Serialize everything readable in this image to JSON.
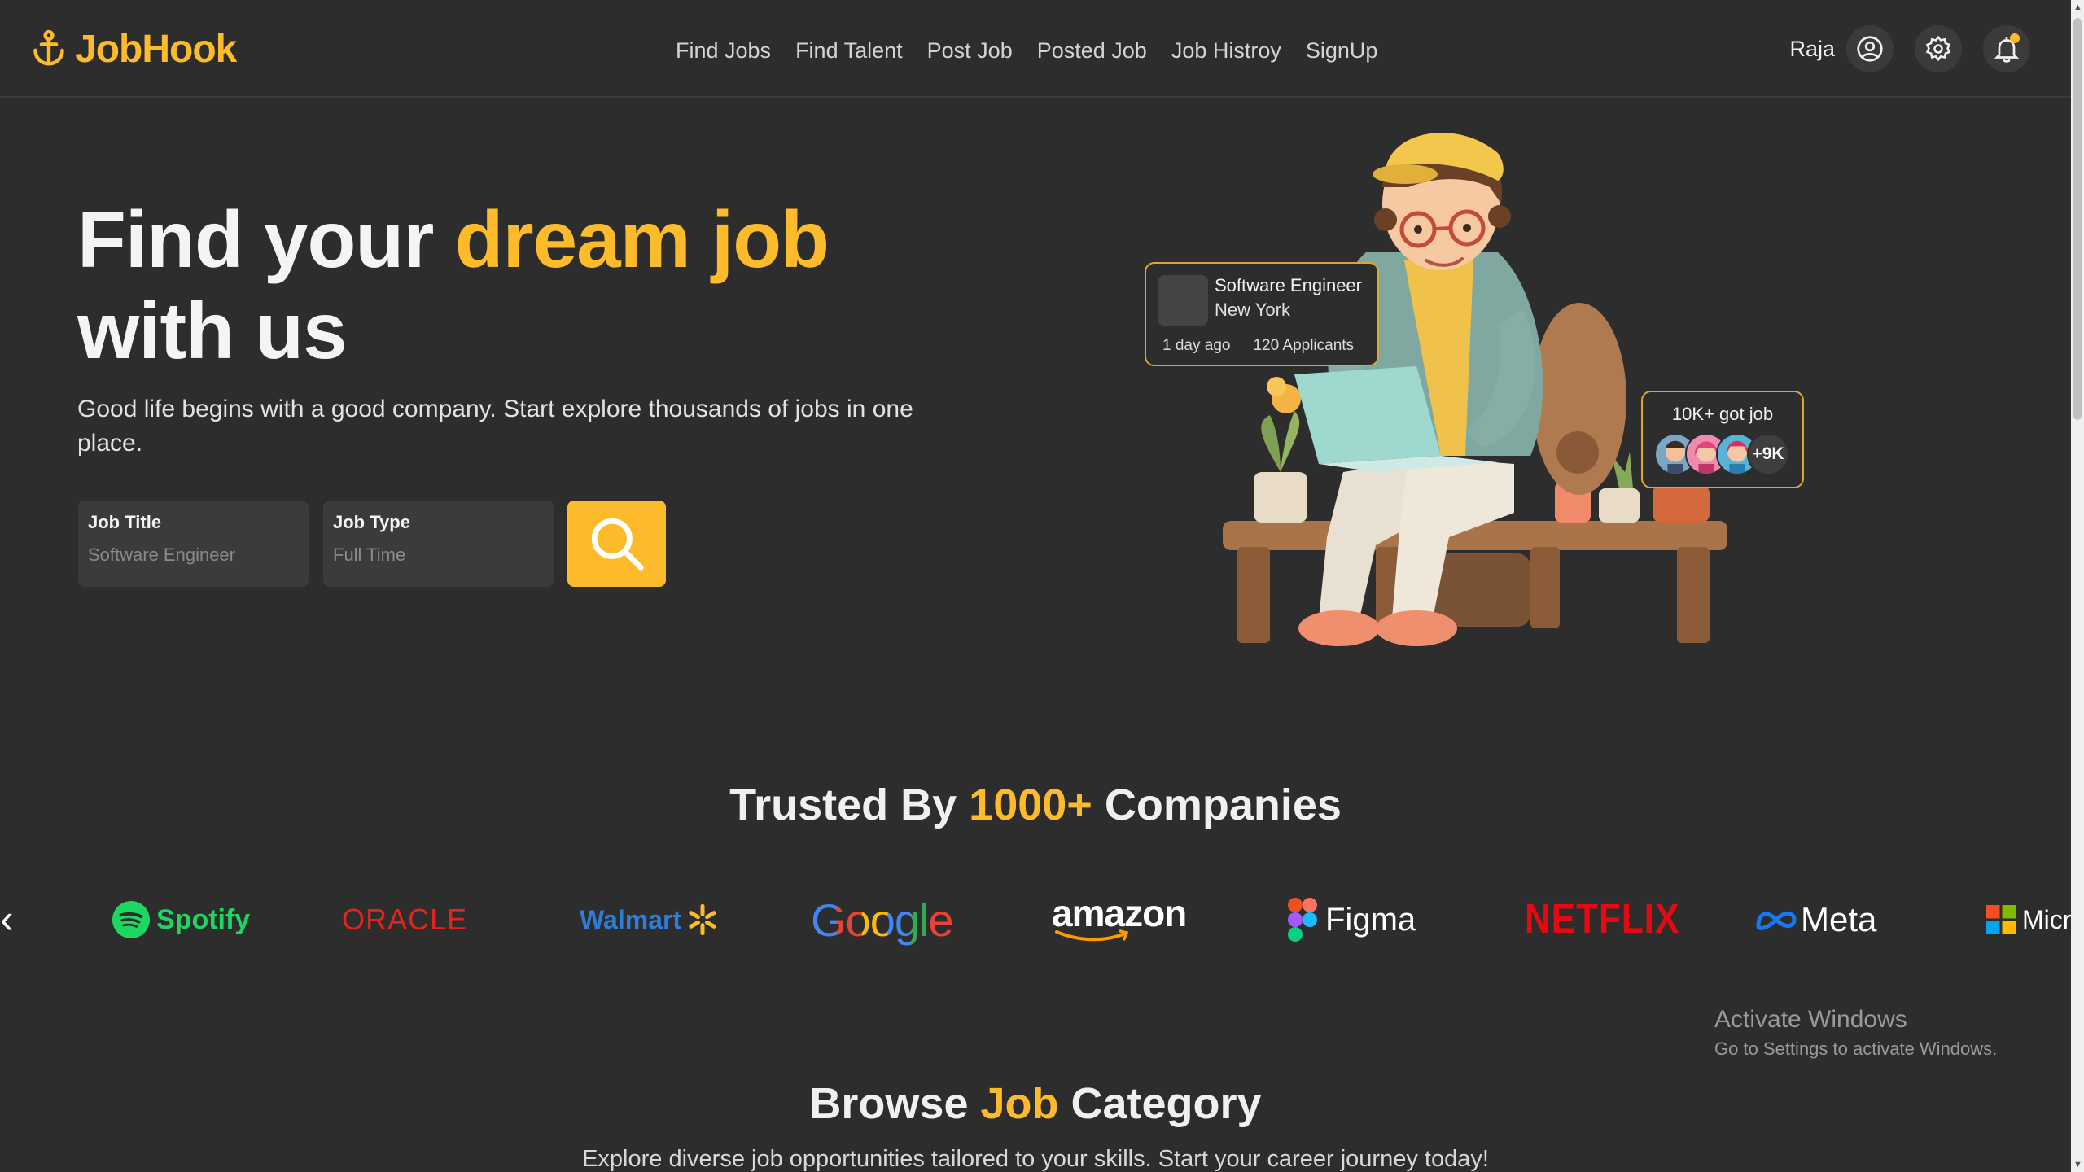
{
  "header": {
    "logo_text": "JobHook",
    "nav": [
      "Find Jobs",
      "Find Talent",
      "Post Job",
      "Posted Job",
      "Job Histroy",
      "SignUp"
    ],
    "user_name": "Raja"
  },
  "hero": {
    "title_part1": "Find your ",
    "title_accent": "dream job",
    "title_part2": "with us",
    "subtitle": "Good life begins with a good company. Start explore thousands of jobs in one place.",
    "job_title_label": "Job Title",
    "job_title_placeholder": "Software Engineer",
    "job_type_label": "Job Type",
    "job_type_placeholder": "Full Time"
  },
  "job_card": {
    "role": "Software Engineer",
    "city": "New York",
    "posted": "1 day ago",
    "applicants": "120 Applicants"
  },
  "got_job": {
    "text": "10K+ got job",
    "more": "+9K"
  },
  "trusted": {
    "title_part1": "Trusted By ",
    "title_accent": "1000+",
    "title_part2": " Companies",
    "companies": [
      "Spotify",
      "ORACLE",
      "Walmart",
      "Google",
      "amazon",
      "Figma",
      "NETFLIX",
      "Meta",
      "Micr"
    ]
  },
  "browse": {
    "title_part1": "Browse ",
    "title_accent": "Job",
    "title_part2": " Category",
    "subtitle": "Explore diverse job opportunities tailored to your skills. Start your career journey today!"
  },
  "watermark": {
    "line1": "Activate Windows",
    "line2": "Go to Settings to activate Windows."
  },
  "colors": {
    "background": "#2d2d2d",
    "accent": "#fdbb2c"
  }
}
